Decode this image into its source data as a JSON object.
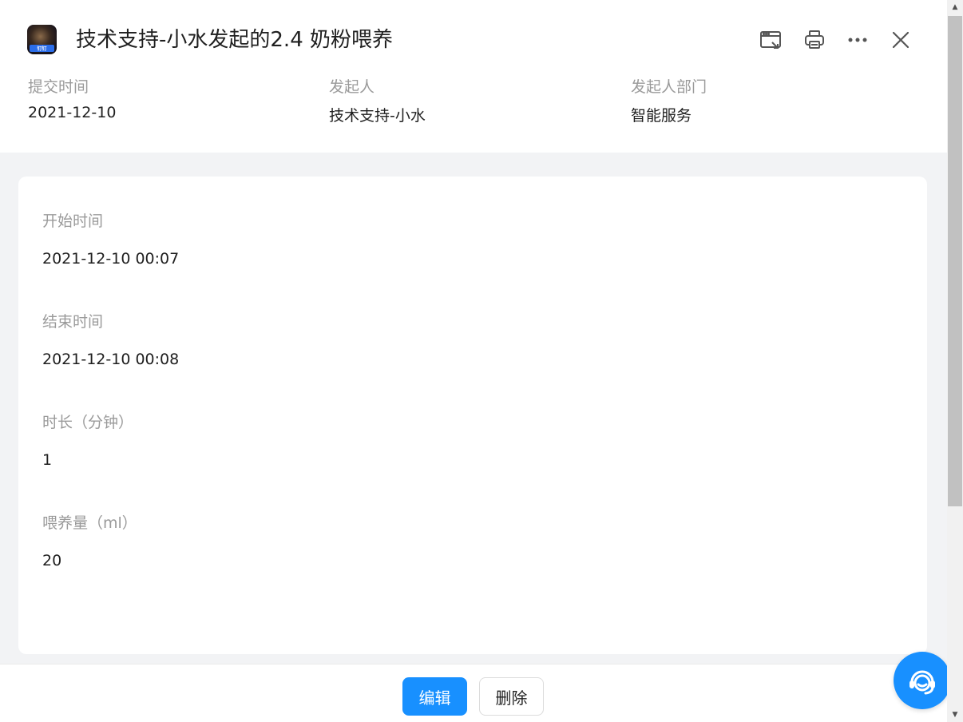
{
  "header": {
    "title": "技术支持-小水发起的2.4 奶粉喂养",
    "logo_badge": "钉钉",
    "meta": [
      {
        "label": "提交时间",
        "value": "2021-12-10"
      },
      {
        "label": "发起人",
        "value": "技术支持-小水"
      },
      {
        "label": "发起人部门",
        "value": "智能服务"
      }
    ],
    "tools": [
      "open-window-icon",
      "print-icon",
      "more-icon",
      "close-icon"
    ]
  },
  "fields": [
    {
      "label": "开始时间",
      "value": "2021-12-10 00:07"
    },
    {
      "label": "结束时间",
      "value": "2021-12-10 00:08"
    },
    {
      "label": "时长（分钟）",
      "value": "1"
    },
    {
      "label": "喂养量（ml）",
      "value": "20"
    }
  ],
  "footer": {
    "edit_label": "编辑",
    "delete_label": "删除"
  },
  "colors": {
    "primary": "#1890ff",
    "label_gray": "#9a9a9a",
    "page_bg": "#f2f3f5"
  }
}
